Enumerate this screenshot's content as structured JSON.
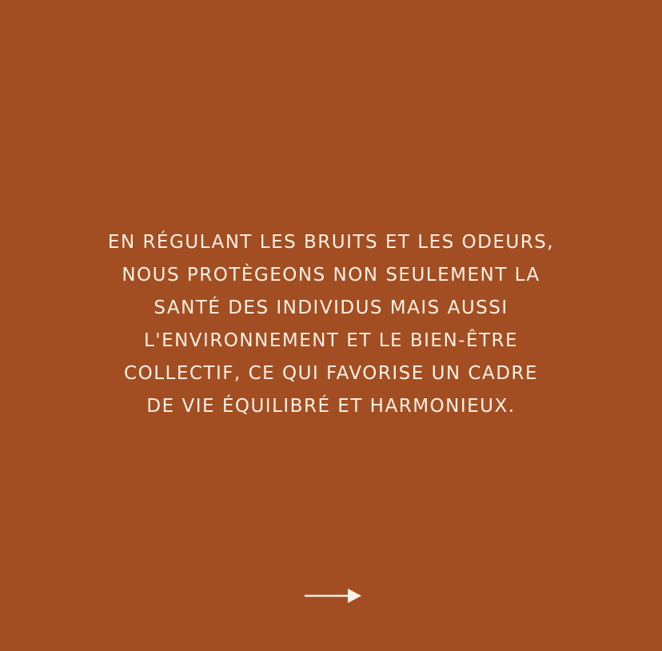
{
  "slide": {
    "background_color": "#a34e22",
    "text_color": "#fbf1e6",
    "lines": [
      "EN RÉGULANT LES BRUITS ET LES ODEURS,",
      "NOUS PROTÈGEONS NON SEULEMENT LA",
      "SANTÉ DES INDIVIDUS MAIS AUSSI",
      "L'ENVIRONNEMENT ET LE BIEN-ÊTRE",
      "COLLECTIF, CE QUI FAVORISE UN CADRE",
      "DE VIE ÉQUILIBRÉ ET HARMONIEUX."
    ],
    "next_icon": "arrow-right-icon"
  }
}
